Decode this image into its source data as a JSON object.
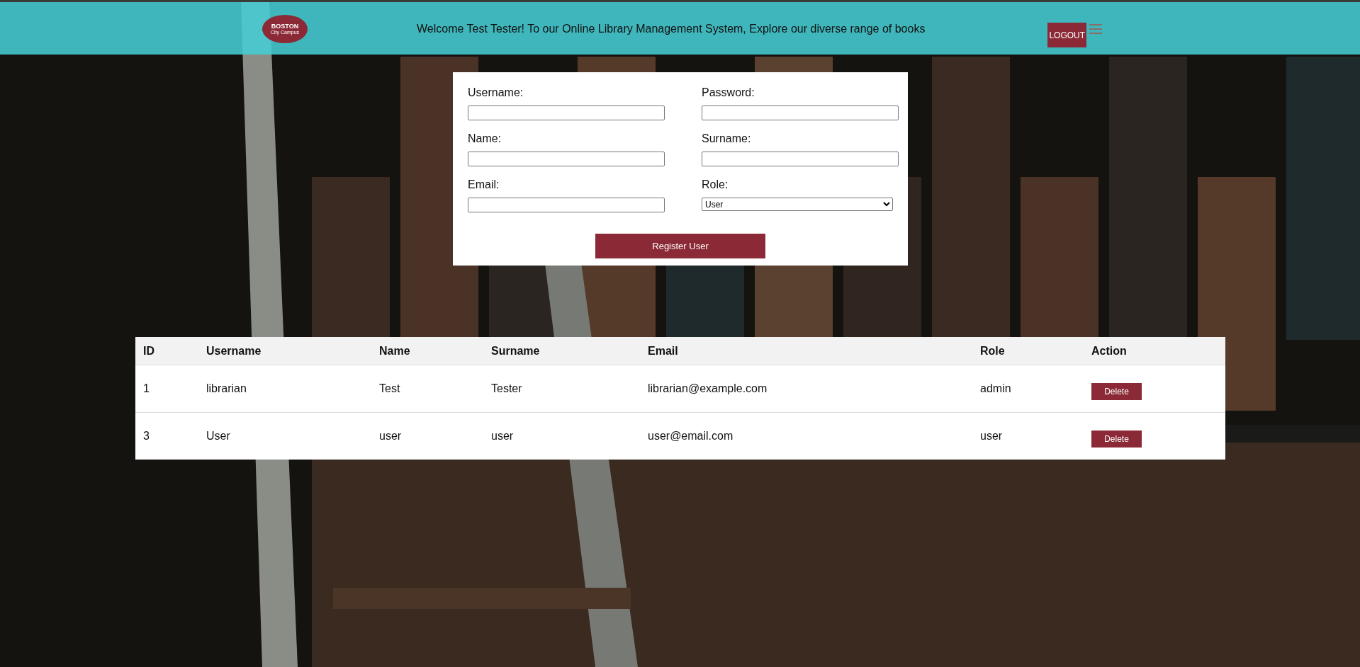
{
  "header": {
    "logo": {
      "title": "BOSTON",
      "subtitle": "City Campus"
    },
    "welcome": "Welcome Test Tester! To our Online Library Management System, Explore our diverse range of books",
    "logout": "LOGOUT"
  },
  "form": {
    "fields": [
      {
        "kind": "input",
        "label": "Username:"
      },
      {
        "kind": "input",
        "label": "Password:"
      },
      {
        "kind": "input",
        "label": "Name:"
      },
      {
        "kind": "input",
        "label": "Surname:"
      },
      {
        "kind": "input",
        "label": "Email:"
      },
      {
        "kind": "select",
        "label": "Role:",
        "value": "User"
      }
    ],
    "submit": "Register User"
  },
  "table": {
    "columns": [
      "ID",
      "Username",
      "Name",
      "Surname",
      "Email",
      "Role",
      "Action"
    ],
    "rows": [
      {
        "cells": [
          "1",
          "librarian",
          "Test",
          "Tester",
          "librarian@example.com",
          "admin"
        ],
        "action": "Delete"
      },
      {
        "cells": [
          "3",
          "User",
          "user",
          "user",
          "user@email.com",
          "user"
        ],
        "action": "Delete"
      }
    ]
  }
}
